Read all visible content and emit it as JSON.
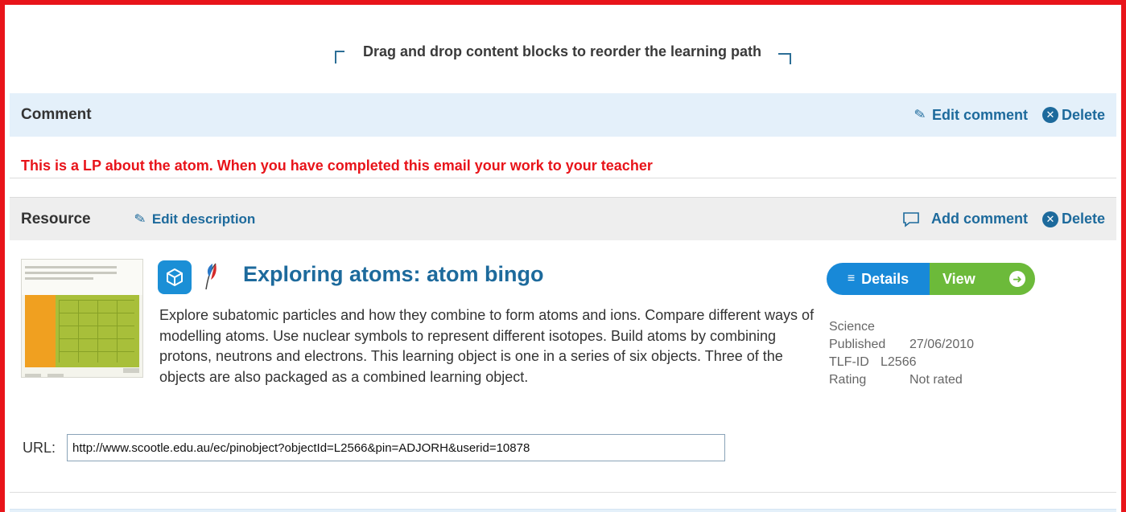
{
  "hint": {
    "text": "Drag and drop content blocks to reorder the learning path"
  },
  "comment_block": {
    "title": "Comment",
    "edit_label": "Edit comment",
    "delete_label": "Delete",
    "text": "This is a LP about the atom. When you have completed this email your work to your teacher"
  },
  "resource_block": {
    "title": "Resource",
    "edit_description_label": "Edit description",
    "add_comment_label": "Add comment",
    "delete_label": "Delete",
    "resource_title": "Exploring atoms: atom bingo",
    "description": "Explore subatomic particles and how they combine to form atoms and ions. Compare different ways of modelling atoms. Use nuclear symbols to represent different isotopes. Build atoms by combining protons, neutrons and electrons. This learning object is one in a series of six objects. Three of the objects are also packaged as a combined learning object.",
    "url_label": "URL:",
    "url_value": "http://www.scootle.edu.au/ec/pinobject?objectId=L2566&pin=ADJORH&userid=10878",
    "details_label": "Details",
    "view_label": "View",
    "meta": {
      "subject": "Science",
      "published_key": "Published",
      "published_value": "27/06/2010",
      "tlf_key": "TLF-ID",
      "tlf_value": "L2566",
      "rating_key": "Rating",
      "rating_value": "Not rated"
    }
  },
  "colors": {
    "frame": "#e8141a",
    "link": "#1d6a9c",
    "comment_bar": "#e4f0fa",
    "details_button": "#1889d8",
    "view_button": "#6cba3a"
  },
  "icons": [
    "drag-arrow-icon",
    "pencil-icon",
    "delete-icon",
    "comment-bubble-icon",
    "cube-icon",
    "feather-icon",
    "menu-icon",
    "arrow-right-circle-icon"
  ]
}
